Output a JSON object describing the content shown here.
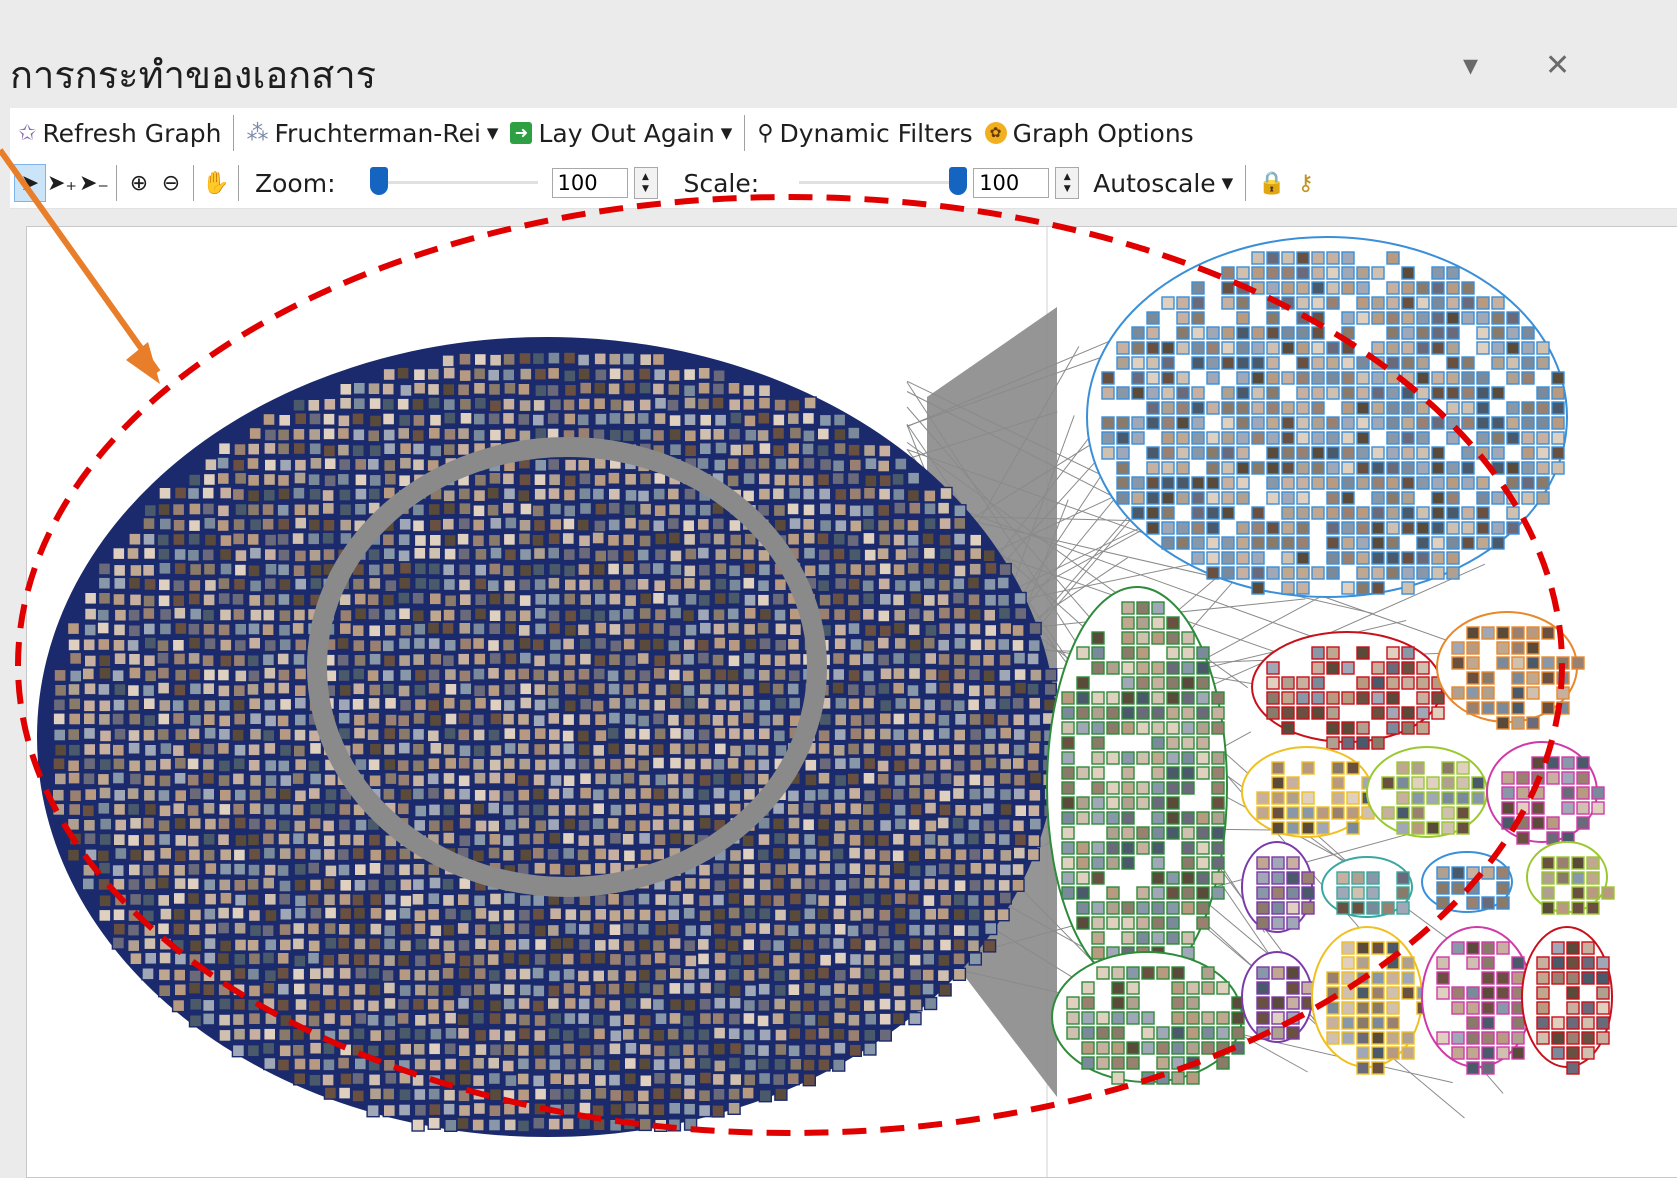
{
  "pane": {
    "title": "การกระทำของเอกสาร",
    "dropdown_glyph": "▾",
    "close_glyph": "✕"
  },
  "toolbar1": {
    "refresh_label": "Refresh Graph",
    "layout_label": "Fruchterman-Rei",
    "layout_again_label": "Lay Out Again",
    "dynamic_filters_label": "Dynamic Filters",
    "graph_options_label": "Graph Options",
    "icons": {
      "refresh": "refresh-graph-icon",
      "layout": "layout-algorithm-icon",
      "layout_again": "lay-out-again-icon",
      "filter": "filter-icon",
      "graph_options": "graph-options-icon"
    }
  },
  "toolbar2": {
    "zoom_label": "Zoom:",
    "zoom_value": "100",
    "zoom_level": 0.0,
    "scale_label": "Scale:",
    "scale_value": "100",
    "scale_level": 1.0,
    "autoscale_label": "Autoscale"
  },
  "graph": {
    "edge_color": "#8a8a8a",
    "main_cluster_border": "#1a2a6c",
    "groups": [
      {
        "name": "blue",
        "color": "#3a8fd8"
      },
      {
        "name": "green",
        "color": "#2e8b3a"
      },
      {
        "name": "red",
        "color": "#c8101a"
      },
      {
        "name": "orange",
        "color": "#e8882a"
      },
      {
        "name": "yellow",
        "color": "#f0c020"
      },
      {
        "name": "lime",
        "color": "#9ac830"
      },
      {
        "name": "magenta",
        "color": "#d03aa8"
      },
      {
        "name": "purple",
        "color": "#7a3aa8"
      },
      {
        "name": "teal",
        "color": "#3aa8a0"
      }
    ]
  },
  "annotations": {
    "arrow_color": "#e87d2a",
    "ellipse_color": "#e00000"
  }
}
